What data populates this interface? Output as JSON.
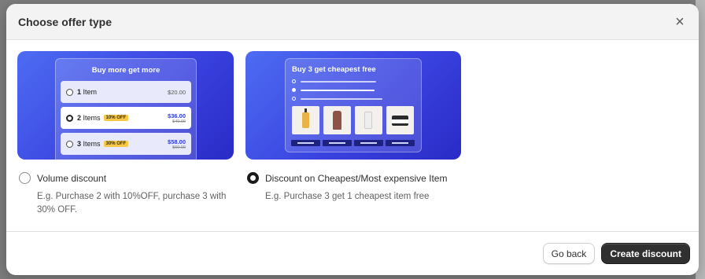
{
  "modal": {
    "title": "Choose offer type",
    "close_icon": "close-icon"
  },
  "options": [
    {
      "label": "Volume discount",
      "description": "E.g. Purchase 2 with 10%OFF, purchase 3 with 30% OFF.",
      "selected": false,
      "preview": {
        "title": "Buy more get more",
        "tiers": [
          {
            "qty": "1",
            "unit": "Item",
            "badge": "",
            "price": "$20.00",
            "was": ""
          },
          {
            "qty": "2",
            "unit": "Items",
            "badge": "10% OFF",
            "price": "$36.00",
            "was": "$40.00"
          },
          {
            "qty": "3",
            "unit": "Items",
            "badge": "30% OFF",
            "price": "$58.00",
            "was": "$60.00"
          }
        ]
      }
    },
    {
      "label": "Discount on Cheapest/Most expensive Item",
      "description": "E.g. Purchase 3 get 1 cheapest item free",
      "selected": true,
      "preview": {
        "title": "Buy 3 get cheapest free"
      }
    }
  ],
  "footer": {
    "back_label": "Go back",
    "create_label": "Create discount"
  },
  "colors": {
    "accent": "#3a43e0",
    "primary_button": "#303030",
    "badge": "#f7c948"
  }
}
